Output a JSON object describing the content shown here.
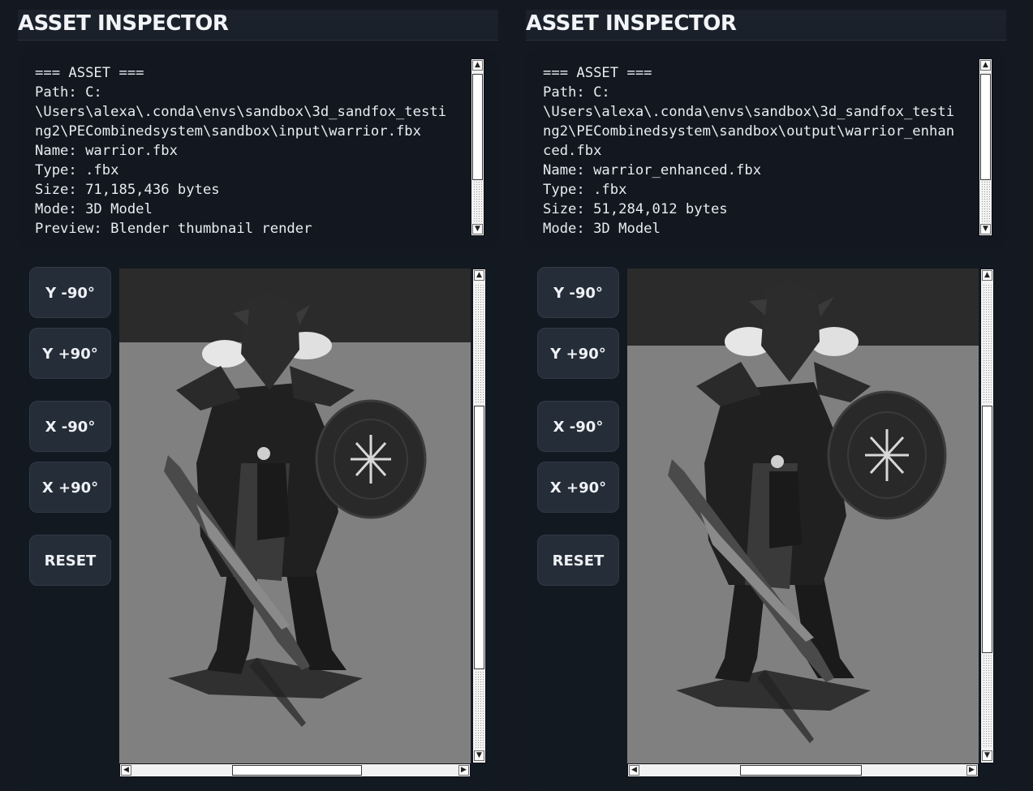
{
  "panels": [
    {
      "title": "ASSET INSPECTOR",
      "info_text": "=== ASSET ===\nPath: C:\n\\Users\\alexa\\.conda\\envs\\sandbox\\3d_sandfox_testi\nng2\\PECombinedsystem\\sandbox\\input\\warrior.fbx\nName: warrior.fbx\nType: .fbx\nSize: 71,185,436 bytes\nMode: 3D Model\nPreview: Blender thumbnail render",
      "buttons": {
        "y_minus": "Y -90°",
        "y_plus": "Y +90°",
        "x_minus": "X -90°",
        "x_plus": "X +90°",
        "reset": "RESET"
      },
      "preview_icon": "warrior-model-render"
    },
    {
      "title": "ASSET INSPECTOR",
      "info_text": "=== ASSET ===\nPath: C:\n\\Users\\alexa\\.conda\\envs\\sandbox\\3d_sandfox_testi\nng2\\PECombinedsystem\\sandbox\\output\\warrior_enhan\nced.fbx\nName: warrior_enhanced.fbx\nType: .fbx\nSize: 51,284,012 bytes\nMode: 3D Model",
      "buttons": {
        "y_minus": "Y -90°",
        "y_plus": "Y +90°",
        "x_minus": "X -90°",
        "x_plus": "X +90°",
        "reset": "RESET"
      },
      "preview_icon": "warrior-model-render"
    }
  ],
  "colors": {
    "background": "#141921",
    "panel": "#121720",
    "button": "#252d38",
    "render_backdrop": "#2b2b2b",
    "render_floor": "#808080"
  }
}
